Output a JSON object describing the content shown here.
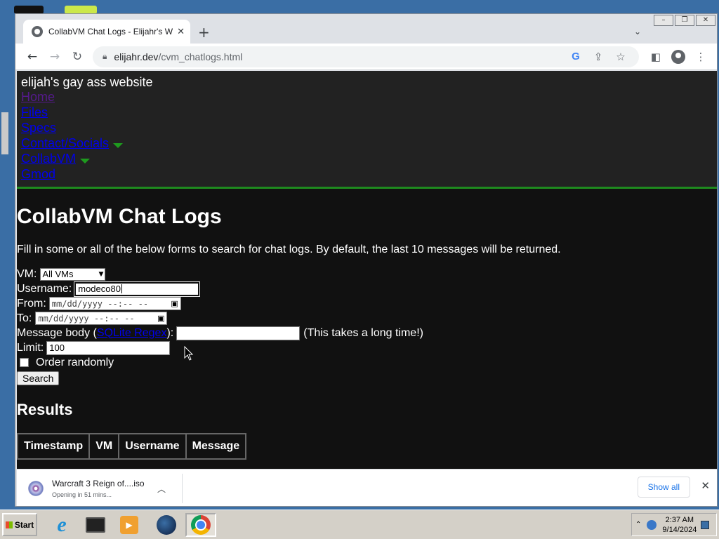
{
  "browser": {
    "tab_title": "CollabVM Chat Logs - Elijahr's Webs",
    "url_host": "elijahr.dev",
    "url_path": "/cvm_chatlogs.html"
  },
  "site": {
    "title": "elijah's gay ass website",
    "nav": [
      "Home",
      "Files",
      "Specs",
      "Contact/Socials",
      "CollabVM",
      "Gmod"
    ]
  },
  "page": {
    "heading": "CollabVM Chat Logs",
    "intro": "Fill in some or all of the below forms to search for chat logs. By default, the last 10 messages will be returned."
  },
  "form": {
    "vm_label": "VM:",
    "vm_selected": "All VMs",
    "username_label": "Username:",
    "username_value": "modeco80",
    "from_label": "From:",
    "date_placeholder": "mm/dd/yyyy --:-- --",
    "to_label": "To:",
    "message_label_prefix": "Message body (",
    "message_link": "SQLite Regex",
    "message_label_suffix": "):",
    "message_note": "(This takes a long time!)",
    "limit_label": "Limit:",
    "limit_value": "100",
    "order_label": "Order randomly",
    "search_button": "Search"
  },
  "results": {
    "heading": "Results",
    "columns": [
      "Timestamp",
      "VM",
      "Username",
      "Message"
    ]
  },
  "download": {
    "file_name": "Warcraft 3 Reign of....iso",
    "status": "Opening in 51 mins...",
    "show_all": "Show all"
  },
  "taskbar": {
    "start_label": "Start",
    "time": "2:37 AM",
    "date": "9/14/2024"
  },
  "colors": {
    "page_bg": "#111111",
    "header_bg": "#222222",
    "header_border": "#1e8a1e",
    "link": "#0000ee",
    "visited_link": "#551a8b"
  }
}
